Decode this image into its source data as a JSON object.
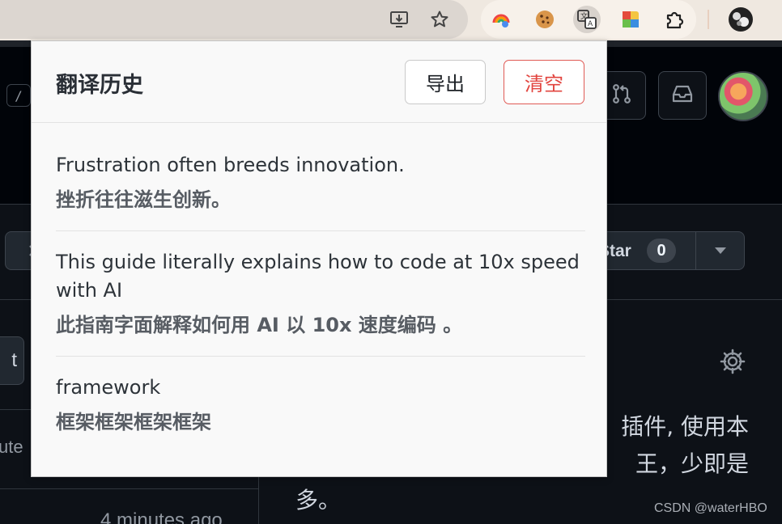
{
  "browser": {
    "toolbar_icons": [
      "install-app-icon",
      "bookmark-star-icon"
    ],
    "extensions": [
      "rainbow-extension-icon",
      "cookie-extension-icon",
      "translate-extension-icon",
      "palette-extension-icon",
      "extensions-puzzle-icon"
    ],
    "profile": "profile-avatar"
  },
  "page": {
    "search_key_hint": "/",
    "star_label": "Star",
    "star_count": "0",
    "partial_button_text": "t",
    "partial_label": "ute",
    "time_ago": "4 minutes ago",
    "description_line1": "插件, 使用本",
    "description_line2": "王，少即是",
    "description_line3": "多。"
  },
  "popup": {
    "title": "翻译历史",
    "export_label": "导出",
    "clear_label": "清空",
    "entries": [
      {
        "source": "Frustration often breeds innovation.",
        "translation": "挫折往往滋生创新。"
      },
      {
        "source": "This guide literally explains how to code at 10x speed with AI",
        "translation": "此指南字面解释如何用 AI 以 10x 速度编码 。"
      },
      {
        "source": "framework",
        "translation": "框架框架框架框架"
      }
    ]
  },
  "watermark": "CSDN @waterHBO",
  "colors": {
    "clear_accent": "#e2453f",
    "github_bg": "#0d1117",
    "popup_bg": "#f9f9f9"
  }
}
